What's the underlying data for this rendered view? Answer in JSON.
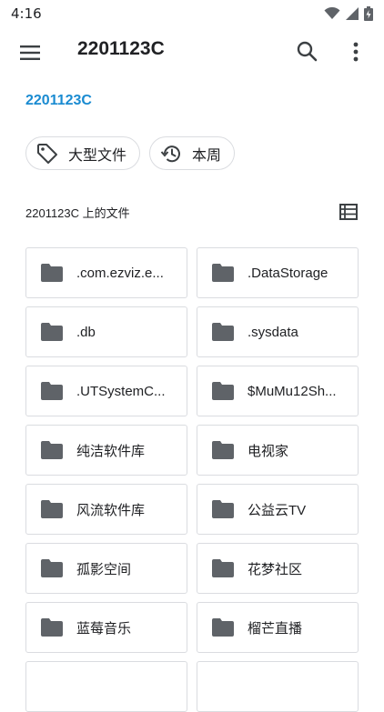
{
  "status_bar": {
    "time": "4:16"
  },
  "app_bar": {
    "title": "2201123C"
  },
  "breadcrumb": {
    "current": "2201123C"
  },
  "filters": [
    {
      "label": "大型文件",
      "icon": "tag-icon"
    },
    {
      "label": "本周",
      "icon": "history-icon"
    }
  ],
  "section": {
    "label": "2201123C 上的文件"
  },
  "folders": [
    {
      "name": ".com.ezviz.e..."
    },
    {
      "name": ".DataStorage"
    },
    {
      "name": ".db"
    },
    {
      "name": ".sysdata"
    },
    {
      "name": ".UTSystemC..."
    },
    {
      "name": "$MuMu12Sh..."
    },
    {
      "name": "纯洁软件库"
    },
    {
      "name": "电视家"
    },
    {
      "name": "风流软件库"
    },
    {
      "name": "公益云TV"
    },
    {
      "name": "孤影空间"
    },
    {
      "name": "花梦社区"
    },
    {
      "name": "蓝莓音乐"
    },
    {
      "name": "榴芒直播"
    }
  ],
  "colors": {
    "accent": "#1a8bd1",
    "icon_gray": "#5f6368",
    "border": "#dadce0"
  }
}
